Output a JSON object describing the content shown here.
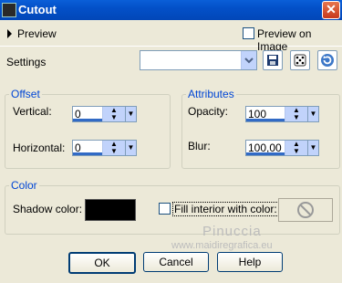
{
  "window": {
    "title": "Cutout",
    "close_glyph": "✕"
  },
  "preview": {
    "label": "Preview",
    "preview_on_image_label": "Preview on Image"
  },
  "settings": {
    "label": "Settings",
    "value": ""
  },
  "offset": {
    "title": "Offset",
    "vertical_label": "Vertical:",
    "vertical_value": "0",
    "horizontal_label": "Horizontal:",
    "horizontal_value": "0"
  },
  "attributes": {
    "title": "Attributes",
    "opacity_label": "Opacity:",
    "opacity_value": "100",
    "blur_label": "Blur:",
    "blur_value": "100,00"
  },
  "color": {
    "title": "Color",
    "shadow_label": "Shadow color:",
    "shadow_color": "#000000",
    "fill_label": "Fill interior with color:"
  },
  "watermark": {
    "name": "Pinuccia",
    "url": "www.maidiregrafica.eu"
  },
  "buttons": {
    "ok": "OK",
    "cancel": "Cancel",
    "help": "Help"
  }
}
